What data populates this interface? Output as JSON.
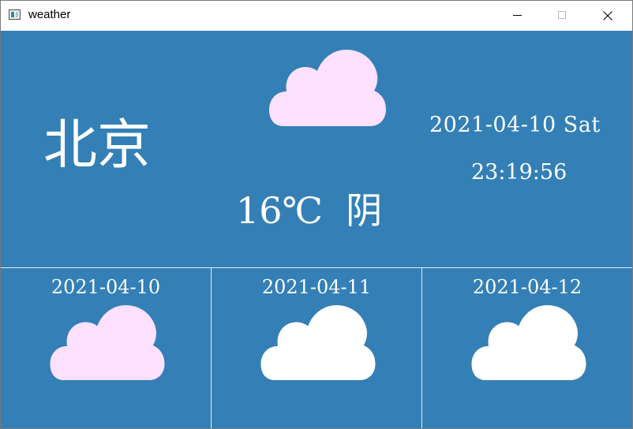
{
  "window": {
    "title": "weather"
  },
  "current": {
    "city": "北京",
    "temperature": "16℃",
    "condition": "阴",
    "date": "2021-04-10 Sat",
    "time": "23:19:56",
    "icon": "cloud-icon",
    "icon_color": "#fde1ff"
  },
  "forecast": [
    {
      "date": "2021-04-10",
      "icon": "cloud-icon",
      "icon_color": "#fde1ff"
    },
    {
      "date": "2021-04-11",
      "icon": "cloud-icon",
      "icon_color": "#ffffff"
    },
    {
      "date": "2021-04-12",
      "icon": "cloud-icon",
      "icon_color": "#ffffff"
    }
  ],
  "colors": {
    "background": "#3480b6",
    "divider": "#e6eef6",
    "text": "#ffffff"
  }
}
